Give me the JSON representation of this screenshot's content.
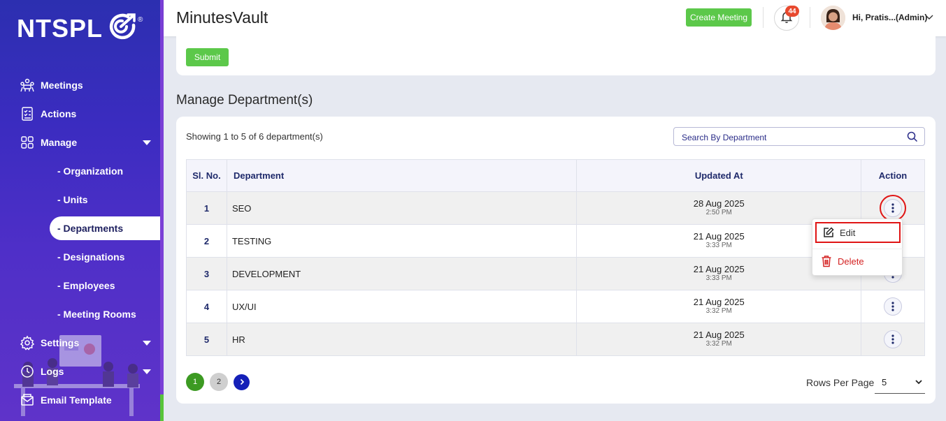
{
  "brand": {
    "logo_text": "NTSPL",
    "registered": "®"
  },
  "sidebar": {
    "items": [
      {
        "label": "Meetings"
      },
      {
        "label": "Actions"
      },
      {
        "label": "Manage"
      },
      {
        "label": "Settings"
      },
      {
        "label": "Logs"
      },
      {
        "label": "Email Template"
      }
    ],
    "manage_subitems": [
      {
        "label": "- Organization"
      },
      {
        "label": "- Units"
      },
      {
        "label": "- Departments"
      },
      {
        "label": "- Designations"
      },
      {
        "label": "- Employees"
      },
      {
        "label": "- Meeting Rooms"
      }
    ],
    "active_subitem": "- Departments"
  },
  "header": {
    "app_title": "MinutesVault",
    "create_meeting_label": "Create Meeting",
    "notification_count": "44",
    "user_greeting": "Hi, Pratis...(Admin)"
  },
  "form": {
    "submit_label": "Submit"
  },
  "section": {
    "title": "Manage Department(s)"
  },
  "list": {
    "showing_text": "Showing 1 to 5 of 6 department(s)",
    "search_placeholder": "Search By Department",
    "columns": {
      "sl": "Sl. No.",
      "department": "Department",
      "updated_at": "Updated At",
      "action": "Action"
    },
    "rows": [
      {
        "sl": "1",
        "department": "SEO",
        "date": "28 Aug 2025",
        "time": "2:50 PM"
      },
      {
        "sl": "2",
        "department": "TESTING",
        "date": "21 Aug 2025",
        "time": "3:33 PM"
      },
      {
        "sl": "3",
        "department": "DEVELOPMENT",
        "date": "21 Aug 2025",
        "time": "3:33 PM"
      },
      {
        "sl": "4",
        "department": "UX/UI",
        "date": "21 Aug 2025",
        "time": "3:32 PM"
      },
      {
        "sl": "5",
        "department": "HR",
        "date": "21 Aug 2025",
        "time": "3:32 PM"
      }
    ]
  },
  "pagination": {
    "pages": [
      "1",
      "2"
    ],
    "current_page": "1",
    "rows_per_page_label": "Rows Per Page",
    "rows_per_page_value": "5"
  },
  "action_menu": {
    "edit_label": "Edit",
    "delete_label": "Delete"
  },
  "colors": {
    "accent_green": "#5cc84a",
    "sidebar_blue": "#3b2cc0",
    "danger_red": "#d42020",
    "heading_navy": "#1f2a6b"
  },
  "icons": {
    "meetings": "meetings-icon",
    "actions": "checklist-icon",
    "manage": "grid-icon",
    "settings": "gear-icon",
    "logs": "clock-icon",
    "email": "envelope-icon",
    "notifications": "bell-icon",
    "search": "search-icon",
    "more": "kebab-icon",
    "edit": "edit-icon",
    "delete": "trash-icon"
  }
}
